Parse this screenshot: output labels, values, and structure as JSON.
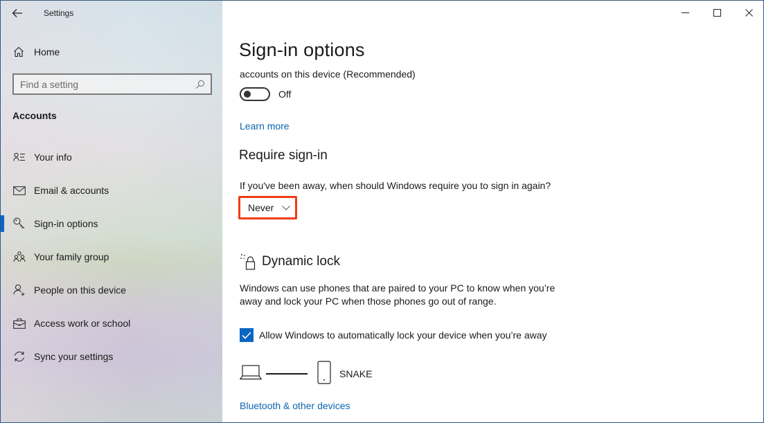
{
  "window": {
    "app_title": "Settings",
    "controls": [
      "minimize",
      "maximize",
      "close"
    ]
  },
  "sidebar": {
    "home_label": "Home",
    "search": {
      "placeholder": "Find a setting",
      "value": ""
    },
    "section_label": "Accounts",
    "items": [
      {
        "label": "Your info",
        "icon": "person-list-icon",
        "active": false
      },
      {
        "label": "Email & accounts",
        "icon": "mail-icon",
        "active": false
      },
      {
        "label": "Sign-in options",
        "icon": "key-icon",
        "active": true
      },
      {
        "label": "Your family group",
        "icon": "family-icon",
        "active": false
      },
      {
        "label": "People on this device",
        "icon": "person-add-icon",
        "active": false
      },
      {
        "label": "Access work or school",
        "icon": "briefcase-icon",
        "active": false
      },
      {
        "label": "Sync your settings",
        "icon": "sync-icon",
        "active": false
      }
    ]
  },
  "main": {
    "page_title": "Sign-in options",
    "truncated_text": "accounts on this device (Recommended)",
    "toggle": {
      "state_label": "Off",
      "on": false
    },
    "learn_more": "Learn more",
    "require_signin": {
      "heading": "Require sign-in",
      "question": "If you've been away, when should Windows require you to sign in again?",
      "dropdown_value": "Never",
      "highlight_color": "#f03c12"
    },
    "dynamic_lock": {
      "heading": "Dynamic lock",
      "description": "Windows can use phones that are paired to your PC to know when you’re away and lock your PC when those phones go out of range.",
      "checkbox_label": "Allow Windows to automatically lock your device when you’re away",
      "checkbox_checked": true,
      "paired_device": "SNAKE",
      "bluetooth_link": "Bluetooth & other devices"
    }
  },
  "colors": {
    "accent": "#0a66c2",
    "link": "#0a64b0",
    "highlight": "#f03c12"
  }
}
